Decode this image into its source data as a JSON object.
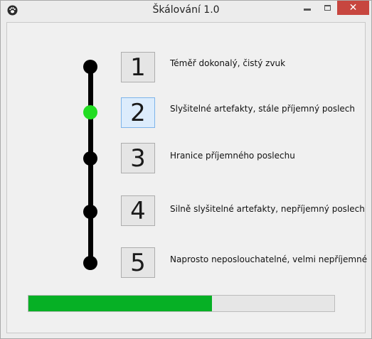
{
  "window": {
    "title": "Škálování 1.0",
    "close_glyph": "✕",
    "icons": {
      "app": "paw-icon",
      "minimize": "minimize-icon",
      "maximize": "maximize-icon",
      "close": "close-icon"
    }
  },
  "scale": {
    "levels": [
      {
        "number": "1",
        "label": "Téměř dokonalý, čistý zvuk"
      },
      {
        "number": "2",
        "label": "Slyšitelné artefakty, stále příjemný poslech"
      },
      {
        "number": "3",
        "label": "Hranice příjemného poslechu"
      },
      {
        "number": "4",
        "label": "Silně slyšitelné artefakty, nepříjemný poslech"
      },
      {
        "number": "5",
        "label": "Naprosto neposlouchatelné, velmi nepříjemné"
      }
    ],
    "selected_level": 2
  },
  "progress": {
    "value_fraction": 0.6
  },
  "colors": {
    "active_dot": "#22dd22",
    "progress_fill": "#06b025",
    "close_button": "#c7463f",
    "selected_button": "#dcecfc"
  }
}
